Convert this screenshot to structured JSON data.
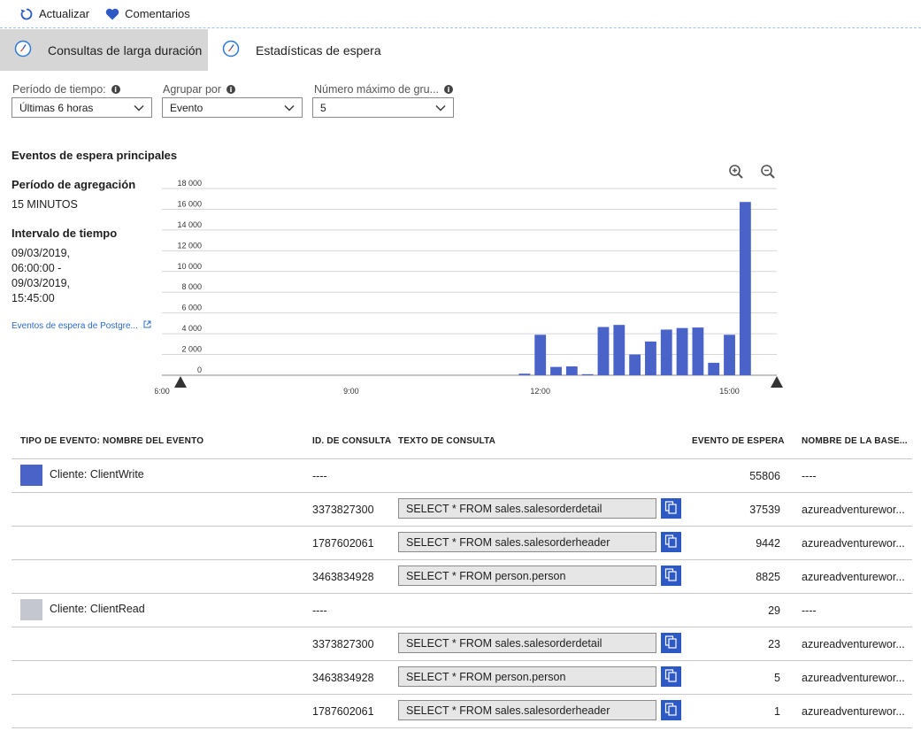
{
  "toolbar": {
    "refresh_label": "Actualizar",
    "feedback_label": "Comentarios"
  },
  "tabs": [
    {
      "label": "Consultas de larga duración",
      "active": false
    },
    {
      "label": "Estadísticas de espera",
      "active": true
    }
  ],
  "filters": {
    "period_label": "Período de tiempo:",
    "period_value": "Últimas 6 horas",
    "group_label": "Agrupar por",
    "group_value": "Evento",
    "max_label": "Número máximo de gru...",
    "max_value": "5"
  },
  "summary": {
    "title": "Eventos de espera principales",
    "agg_heading": "Período de agregación",
    "agg_value": "15 MINUTOS",
    "interval_heading": "Intervalo de tiempo",
    "interval_lines": [
      "09/03/2019,",
      "06:00:00 -",
      "09/03/2019,",
      "15:45:00"
    ],
    "link_label": "Eventos de espera de Postgre..."
  },
  "colors": {
    "accent": "#4a63c8",
    "client_write": "#4a63c8",
    "client_read": "#c4c7cf",
    "copy_button": "#2c59c4"
  },
  "chart_data": {
    "type": "bar",
    "x_tick_labels": [
      "6:00",
      "9:00",
      "12:00",
      "15:00"
    ],
    "y_tick_labels": [
      "0",
      "2 000",
      "4 000",
      "6 000",
      "8 000",
      "10 000",
      "12 000",
      "14 000",
      "16 000",
      "18 000"
    ],
    "ylim": [
      0,
      18000
    ],
    "x_range_hours": [
      6.0,
      15.75
    ],
    "grid": true,
    "series": [
      {
        "x": [
          "11:45",
          "12:00",
          "12:15",
          "12:30",
          "12:45",
          "13:00",
          "13:15",
          "13:30",
          "13:45",
          "14:00",
          "14:15",
          "14:30",
          "14:45",
          "15:00",
          "15:15"
        ],
        "values": [
          150,
          3900,
          800,
          850,
          100,
          4650,
          4850,
          2000,
          3250,
          4400,
          4550,
          4600,
          1200,
          3900,
          16700
        ]
      }
    ]
  },
  "table": {
    "headers": [
      "TIPO DE EVENTO: NOMBRE DEL EVENTO",
      "ID. DE CONSULTA",
      "TEXTO DE CONSULTA",
      "EVENTO DE ESPERA",
      "NOMBRE DE LA BASE..."
    ],
    "rows": [
      {
        "event": "Cliente: ClientWrite",
        "swatch": "#4a63c8",
        "query_id": "----",
        "query_text": "",
        "wait": "55806",
        "db": "----"
      },
      {
        "event": "",
        "query_id": "3373827300",
        "query_text": "SELECT * FROM sales.salesorderdetail",
        "wait": "37539",
        "db": "azureadventurewor..."
      },
      {
        "event": "",
        "query_id": "1787602061",
        "query_text": "SELECT * FROM sales.salesorderheader",
        "wait": "9442",
        "db": "azureadventurewor..."
      },
      {
        "event": "",
        "query_id": "3463834928",
        "query_text": "SELECT * FROM person.person",
        "wait": "8825",
        "db": "azureadventurewor..."
      },
      {
        "event": "Cliente: ClientRead",
        "swatch": "#c4c7cf",
        "query_id": "----",
        "query_text": "",
        "wait": "29",
        "db": "----"
      },
      {
        "event": "",
        "query_id": "3373827300",
        "query_text": "SELECT * FROM sales.salesorderdetail",
        "wait": "23",
        "db": "azureadventurewor..."
      },
      {
        "event": "",
        "query_id": "3463834928",
        "query_text": "SELECT * FROM person.person",
        "wait": "5",
        "db": "azureadventurewor..."
      },
      {
        "event": "",
        "query_id": "1787602061",
        "query_text": "SELECT * FROM sales.salesorderheader",
        "wait": "1",
        "db": "azureadventurewor..."
      }
    ]
  }
}
